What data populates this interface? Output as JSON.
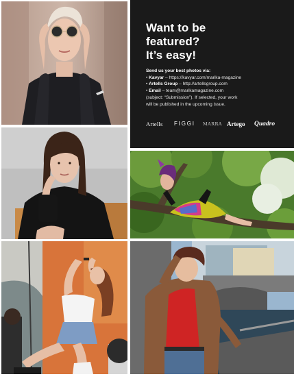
{
  "feature": {
    "headline": [
      "Want to be",
      "featured?",
      "It’s easy!"
    ],
    "send_lead": "Send us your best photos via:",
    "bullets": [
      {
        "name": "Kavyar",
        "detail": " – https://kavyar.com/marika-magazine"
      },
      {
        "name": "Artells Group",
        "detail": " – http://artellsgroup.com"
      },
      {
        "name": "Email",
        "detail": " – team@marikamagazine.com"
      }
    ],
    "note_lines": [
      "(subject: “Submission”). If selected, your work",
      "will be published in the upcoming issue."
    ],
    "bullet_mark": "•"
  },
  "logos": {
    "artells": "Artells",
    "figgi": "FIGGI",
    "marra": "MARRA",
    "artego": "Artego",
    "quadro": "Quadro"
  },
  "photos": [
    {
      "subject": "blonde woman with round sunglasses, hands to face"
    },
    {
      "subject": "dark-haired woman in black sweater, hand on chin"
    },
    {
      "subject": "woman in rainbow sequin outfit reclining on tree branch"
    },
    {
      "subject": "singer with microphone on stage, denim skirt"
    },
    {
      "subject": "woman in red top and brown jacket by river embankment"
    }
  ],
  "colors": {
    "panel": "#1a1a1a",
    "background": "#ffffff"
  }
}
